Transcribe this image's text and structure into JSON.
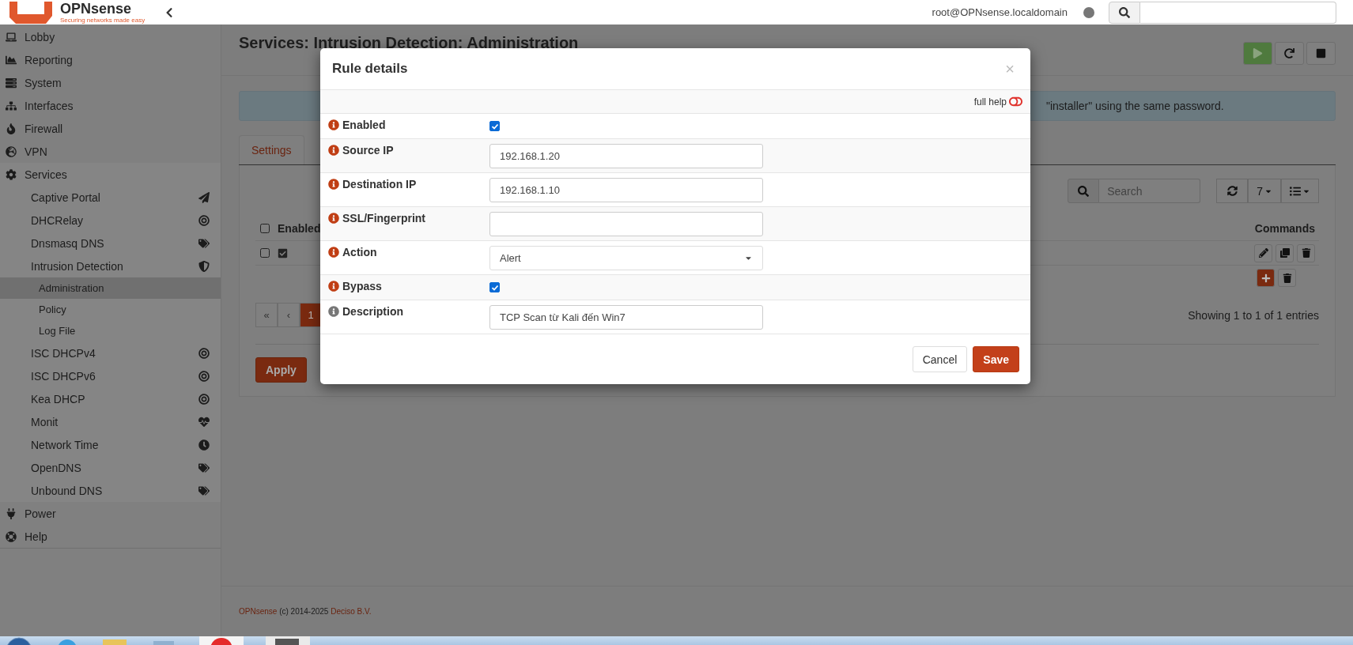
{
  "header": {
    "brand": "OPNsense",
    "tagline": "Securing networks made easy",
    "user": "root@OPNsense.localdomain"
  },
  "sidebar": {
    "items": [
      {
        "label": "Lobby"
      },
      {
        "label": "Reporting"
      },
      {
        "label": "System"
      },
      {
        "label": "Interfaces"
      },
      {
        "label": "Firewall"
      },
      {
        "label": "VPN"
      },
      {
        "label": "Services",
        "expanded": true,
        "children": [
          {
            "label": "Captive Portal"
          },
          {
            "label": "DHCRelay"
          },
          {
            "label": "Dnsmasq DNS"
          },
          {
            "label": "Intrusion Detection",
            "expanded": true,
            "children": [
              {
                "label": "Administration",
                "selected": true
              },
              {
                "label": "Policy",
                "selected": false
              },
              {
                "label": "Log File",
                "selected": false
              }
            ]
          },
          {
            "label": "ISC DHCPv4"
          },
          {
            "label": "ISC DHCPv6"
          },
          {
            "label": "Kea DHCP"
          },
          {
            "label": "Monit"
          },
          {
            "label": "Network Time"
          },
          {
            "label": "OpenDNS"
          },
          {
            "label": "Unbound DNS"
          }
        ]
      },
      {
        "label": "Power"
      },
      {
        "label": "Help"
      }
    ]
  },
  "page": {
    "title": "Services: Intrusion Detection: Administration",
    "banner": "\"installer\" using the same password.",
    "tabs": [
      {
        "label": "Settings",
        "selected": false
      }
    ],
    "search": {
      "placeholder": "Search"
    },
    "page_size": "7",
    "table": {
      "columns": [
        "Enabled",
        "Commands"
      ],
      "select_all": {
        "checked": false
      },
      "rows": [
        {
          "selected": false,
          "enabled": true
        }
      ]
    },
    "pagination": [
      {
        "label": "«",
        "selected": false
      },
      {
        "label": "‹",
        "selected": false
      },
      {
        "label": "1",
        "selected": true
      }
    ],
    "showing": "Showing 1 to 1 of 1 entries",
    "apply": "Apply"
  },
  "footer": {
    "brand": "OPNsense",
    "text": " (c) 2014-2025 ",
    "company": "Deciso B.V."
  },
  "modal": {
    "title": "Rule details",
    "close": "×",
    "full_help": {
      "label": "full help",
      "on": false
    },
    "fields": [
      {
        "label": "Enabled",
        "kind": "checkbox",
        "checked": true,
        "color": "#c03e14"
      },
      {
        "label": "Source IP",
        "kind": "text",
        "value": "192.168.1.20",
        "color": "#c03e14"
      },
      {
        "label": "Destination IP",
        "kind": "text",
        "value": "192.168.1.10",
        "color": "#c03e14"
      },
      {
        "label": "SSL/Fingerprint",
        "kind": "text",
        "color": "#c03e14"
      },
      {
        "label": "Action",
        "kind": "select",
        "value": "Alert",
        "color": "#c03e14"
      },
      {
        "label": "Bypass",
        "kind": "checkbox",
        "checked": true,
        "color": "#c03e14"
      },
      {
        "label": "Description",
        "kind": "text",
        "value": "TCP Scan từ Kali đến Win7",
        "color": "#777777"
      }
    ],
    "buttons": {
      "cancel": "Cancel",
      "save": "Save"
    }
  }
}
